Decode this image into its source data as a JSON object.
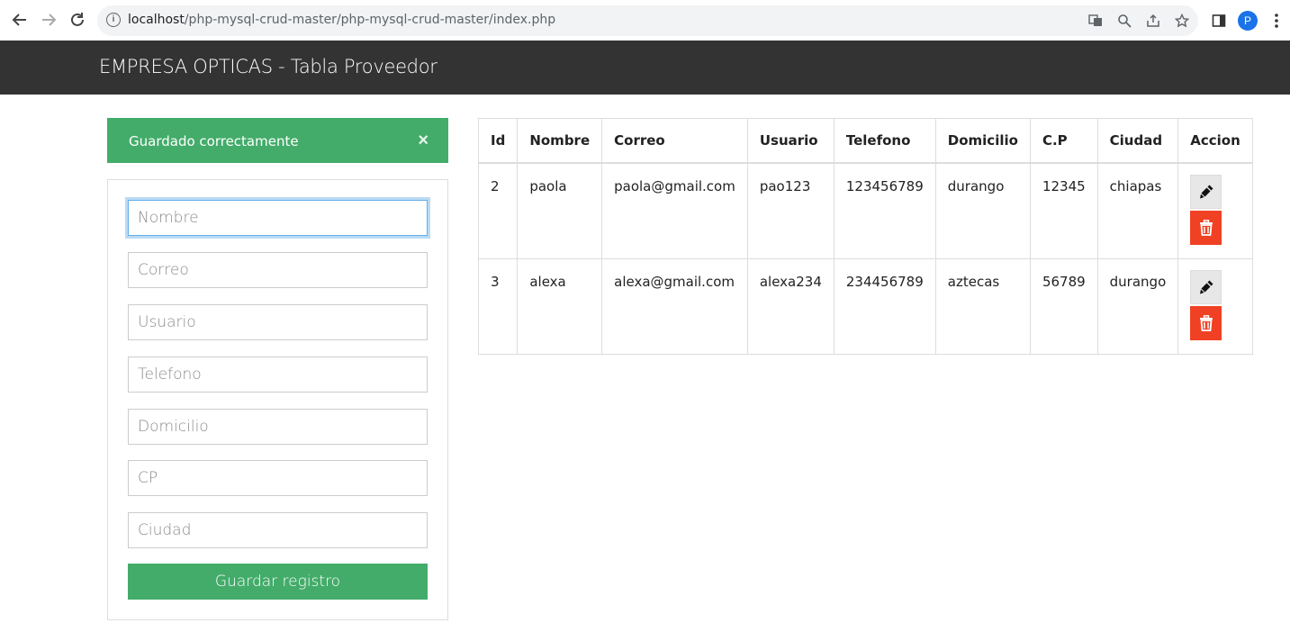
{
  "browser": {
    "url_host": "localhost",
    "url_path": "/php-mysql-crud-master/php-mysql-crud-master/index.php",
    "profile_initial": "P"
  },
  "navbar": {
    "brand": "EMPRESA OPTICAS - Tabla Proveedor"
  },
  "alert": {
    "message": "Guardado correctamente",
    "close": "×",
    "color": "#43ac6a"
  },
  "form": {
    "fields": [
      {
        "placeholder": "Nombre",
        "value": ""
      },
      {
        "placeholder": "Correo",
        "value": ""
      },
      {
        "placeholder": "Usuario",
        "value": ""
      },
      {
        "placeholder": "Telefono",
        "value": ""
      },
      {
        "placeholder": "Domicilio",
        "value": ""
      },
      {
        "placeholder": "CP",
        "value": ""
      },
      {
        "placeholder": "Ciudad",
        "value": ""
      }
    ],
    "submit_label": "Guardar registro"
  },
  "table": {
    "headers": [
      "Id",
      "Nombre",
      "Correo",
      "Usuario",
      "Telefono",
      "Domicilio",
      "C.P",
      "Ciudad",
      "Accion"
    ],
    "rows": [
      [
        "2",
        "paola",
        "paola@gmail.com",
        "pao123",
        "123456789",
        "durango",
        "12345",
        "chiapas"
      ],
      [
        "3",
        "alexa",
        "alexa@gmail.com",
        "alexa234",
        "234456789",
        "aztecas",
        "56789",
        "durango"
      ]
    ],
    "edit_color": "#e7e7e7",
    "delete_color": "#f04124"
  }
}
